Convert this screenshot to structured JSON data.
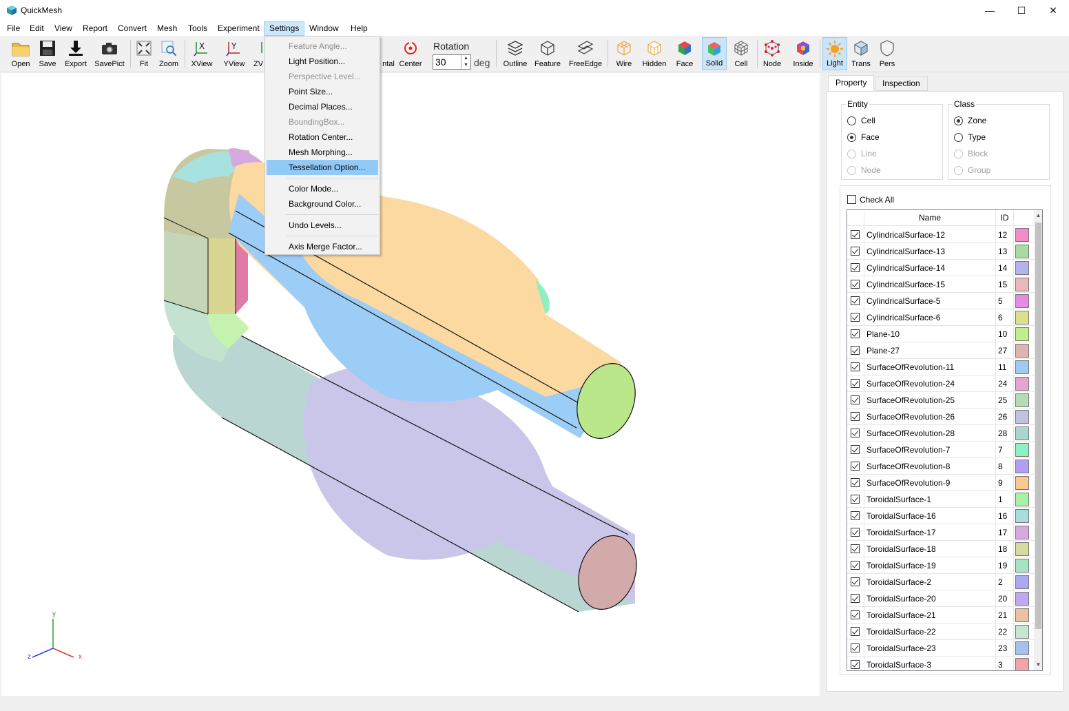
{
  "window": {
    "title": "QuickMesh",
    "min_glyph": "—",
    "max_glyph": "☐",
    "close_glyph": "✕"
  },
  "menu": [
    "File",
    "Edit",
    "View",
    "Report",
    "Convert",
    "Mesh",
    "Tools",
    "Experiment",
    "Settings",
    "Window",
    "Help"
  ],
  "active_menu": "Settings",
  "toolbar": {
    "open": "Open",
    "save": "Save",
    "export": "Export",
    "savepict": "SavePict",
    "fit": "Fit",
    "zoom": "Zoom",
    "xview": "XView",
    "yview": "YView",
    "zview_partial": "ZV",
    "horizontal_partial": "ntal",
    "center": "Center",
    "rotation_label": "Rotation",
    "rotation_value": "30",
    "rotation_unit": "deg",
    "outline": "Outline",
    "feature": "Feature",
    "freeedge": "FreeEdge",
    "wire": "Wire",
    "hidden": "Hidden",
    "face": "Face",
    "solid": "Solid",
    "cell": "Cell",
    "node": "Node",
    "inside": "Inside",
    "light": "Light",
    "trans": "Trans",
    "pers": "Pers",
    "pressed": [
      "Solid",
      "Light"
    ]
  },
  "settings_menu": {
    "items": [
      {
        "label": "Feature Angle...",
        "enabled": false
      },
      {
        "label": "Light Position...",
        "enabled": true
      },
      {
        "label": "Perspective Level...",
        "enabled": false
      },
      {
        "label": "Point Size...",
        "enabled": true
      },
      {
        "label": "Decimal Places...",
        "enabled": true
      },
      {
        "label": "BoundingBox...",
        "enabled": false
      },
      {
        "label": "Rotation Center...",
        "enabled": true
      },
      {
        "label": "Mesh Morphing...",
        "enabled": true
      },
      {
        "label": "Tessellation Option...",
        "enabled": true,
        "highlighted": true
      },
      {
        "label": "Color Mode...",
        "enabled": true
      },
      {
        "label": "Background Color...",
        "enabled": true
      },
      {
        "label": "Undo Levels...",
        "enabled": true
      },
      {
        "label": "Axis Merge Factor...",
        "enabled": true
      }
    ]
  },
  "axes": {
    "y": "y",
    "x": "x",
    "z": "z"
  },
  "panel": {
    "tabs": [
      "Property",
      "Inspection"
    ],
    "active_tab": "Property",
    "entity": {
      "title": "Entity",
      "options": [
        {
          "label": "Cell",
          "checked": false,
          "enabled": true
        },
        {
          "label": "Face",
          "checked": true,
          "enabled": true
        },
        {
          "label": "Line",
          "checked": false,
          "enabled": false
        },
        {
          "label": "Node",
          "checked": false,
          "enabled": false
        }
      ]
    },
    "class": {
      "title": "Class",
      "options": [
        {
          "label": "Zone",
          "checked": true,
          "enabled": true
        },
        {
          "label": "Type",
          "checked": false,
          "enabled": true
        },
        {
          "label": "Block",
          "checked": false,
          "enabled": false
        },
        {
          "label": "Group",
          "checked": false,
          "enabled": false
        }
      ]
    },
    "check_all": "Check All",
    "columns": {
      "name": "Name",
      "id": "ID"
    },
    "rows": [
      {
        "name": "CylindricalSurface-12",
        "id": "12",
        "color": "#f28bc6"
      },
      {
        "name": "CylindricalSurface-13",
        "id": "13",
        "color": "#a8dba0"
      },
      {
        "name": "CylindricalSurface-14",
        "id": "14",
        "color": "#b3b3ee"
      },
      {
        "name": "CylindricalSurface-15",
        "id": "15",
        "color": "#eab8b8"
      },
      {
        "name": "CylindricalSurface-5",
        "id": "5",
        "color": "#e58be6"
      },
      {
        "name": "CylindricalSurface-6",
        "id": "6",
        "color": "#dbe08a"
      },
      {
        "name": "Plane-10",
        "id": "10",
        "color": "#bff08a"
      },
      {
        "name": "Plane-27",
        "id": "27",
        "color": "#dbb6b1"
      },
      {
        "name": "SurfaceOfRevolution-11",
        "id": "11",
        "color": "#9ecbf2"
      },
      {
        "name": "SurfaceOfRevolution-24",
        "id": "24",
        "color": "#e6a4d2"
      },
      {
        "name": "SurfaceOfRevolution-25",
        "id": "25",
        "color": "#b6dcb6"
      },
      {
        "name": "SurfaceOfRevolution-26",
        "id": "26",
        "color": "#c2c2e0"
      },
      {
        "name": "SurfaceOfRevolution-28",
        "id": "28",
        "color": "#a9d6d1"
      },
      {
        "name": "SurfaceOfRevolution-7",
        "id": "7",
        "color": "#8ff0c1"
      },
      {
        "name": "SurfaceOfRevolution-8",
        "id": "8",
        "color": "#b49ef2"
      },
      {
        "name": "SurfaceOfRevolution-9",
        "id": "9",
        "color": "#fbc98e"
      },
      {
        "name": "ToroidalSurface-1",
        "id": "1",
        "color": "#a6f2a6"
      },
      {
        "name": "ToroidalSurface-16",
        "id": "16",
        "color": "#a9dcdc"
      },
      {
        "name": "ToroidalSurface-17",
        "id": "17",
        "color": "#d8a8e0"
      },
      {
        "name": "ToroidalSurface-18",
        "id": "18",
        "color": "#d5da9e"
      },
      {
        "name": "ToroidalSurface-19",
        "id": "19",
        "color": "#a6e3c3"
      },
      {
        "name": "ToroidalSurface-2",
        "id": "2",
        "color": "#aaaaf3"
      },
      {
        "name": "ToroidalSurface-20",
        "id": "20",
        "color": "#c1a9ef"
      },
      {
        "name": "ToroidalSurface-21",
        "id": "21",
        "color": "#ecc1a2"
      },
      {
        "name": "ToroidalSurface-22",
        "id": "22",
        "color": "#c4e8cf"
      },
      {
        "name": "ToroidalSurface-23",
        "id": "23",
        "color": "#a4c2ef"
      },
      {
        "name": "ToroidalSurface-3",
        "id": "3",
        "color": "#f0a6a6"
      }
    ]
  }
}
